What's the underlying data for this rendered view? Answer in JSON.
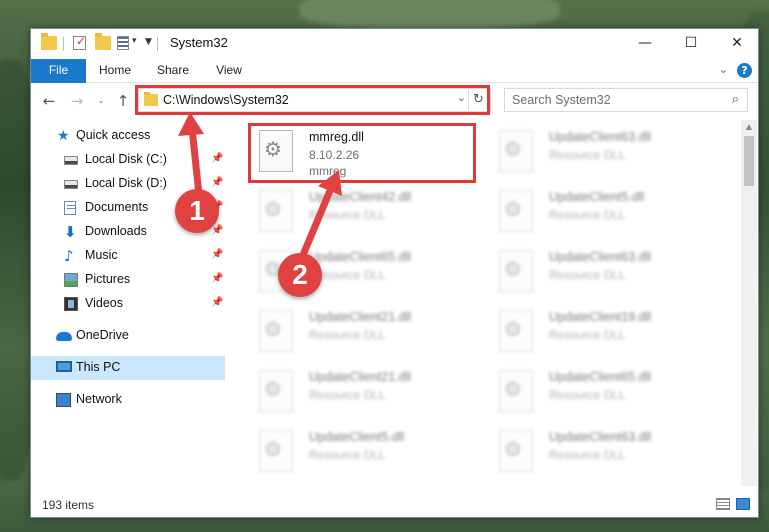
{
  "window": {
    "title": "System32",
    "controls": {
      "minimize": "—",
      "maximize": "☐",
      "close": "✕"
    }
  },
  "ribbon": {
    "tabs": [
      "File",
      "Home",
      "Share",
      "View"
    ],
    "help": "?"
  },
  "navigation": {
    "address": "C:\\Windows\\System32",
    "search_placeholder": "Search System32"
  },
  "sidebar": {
    "items": [
      {
        "label": "Quick access",
        "icon": "star-icon"
      },
      {
        "label": "Local Disk (C:)",
        "icon": "disk-icon",
        "pinned": true
      },
      {
        "label": "Local Disk (D:)",
        "icon": "disk-icon",
        "pinned": true
      },
      {
        "label": "Documents",
        "icon": "documents-icon",
        "pinned": true
      },
      {
        "label": "Downloads",
        "icon": "downloads-icon",
        "pinned": true
      },
      {
        "label": "Music",
        "icon": "music-icon",
        "pinned": true
      },
      {
        "label": "Pictures",
        "icon": "pictures-icon",
        "pinned": true
      },
      {
        "label": "Videos",
        "icon": "videos-icon",
        "pinned": true
      },
      {
        "label": "OneDrive",
        "icon": "onedrive-icon"
      },
      {
        "label": "This PC",
        "icon": "computer-icon",
        "selected": true
      },
      {
        "label": "Network",
        "icon": "network-icon"
      }
    ]
  },
  "files": [
    {
      "name": "mmreg.dll",
      "line2": "8.10.2.26",
      "line3": "mmreg"
    },
    {
      "name": "UpdateClient63.dll",
      "line2": "Resource DLL"
    },
    {
      "name": "UpdateClient42.dll",
      "line2": "Resource DLL"
    },
    {
      "name": "UpdateClient5.dll",
      "line2": "Resource DLL"
    },
    {
      "name": "UpdateClient65.dll",
      "line2": "Resource DLL"
    },
    {
      "name": "UpdateClient63.dll",
      "line2": "Resource DLL"
    },
    {
      "name": "UpdateClient21.dll",
      "line2": "Resource DLL"
    },
    {
      "name": "UpdateClient19.dll",
      "line2": "Resource DLL"
    },
    {
      "name": "UpdateClient21.dll",
      "line2": "Resource DLL"
    },
    {
      "name": "UpdateClient65.dll",
      "line2": "Resource DLL"
    },
    {
      "name": "UpdateClient5.dll",
      "line2": "Resource DLL"
    },
    {
      "name": "UpdateClient63.dll",
      "line2": "Resource DLL"
    }
  ],
  "status": {
    "item_count": "193 items"
  },
  "annotations": {
    "step1": "1",
    "step2": "2"
  },
  "colors": {
    "accent": "#1979ca",
    "highlight": "#dd3b3b",
    "selected": "#cce8ff"
  }
}
